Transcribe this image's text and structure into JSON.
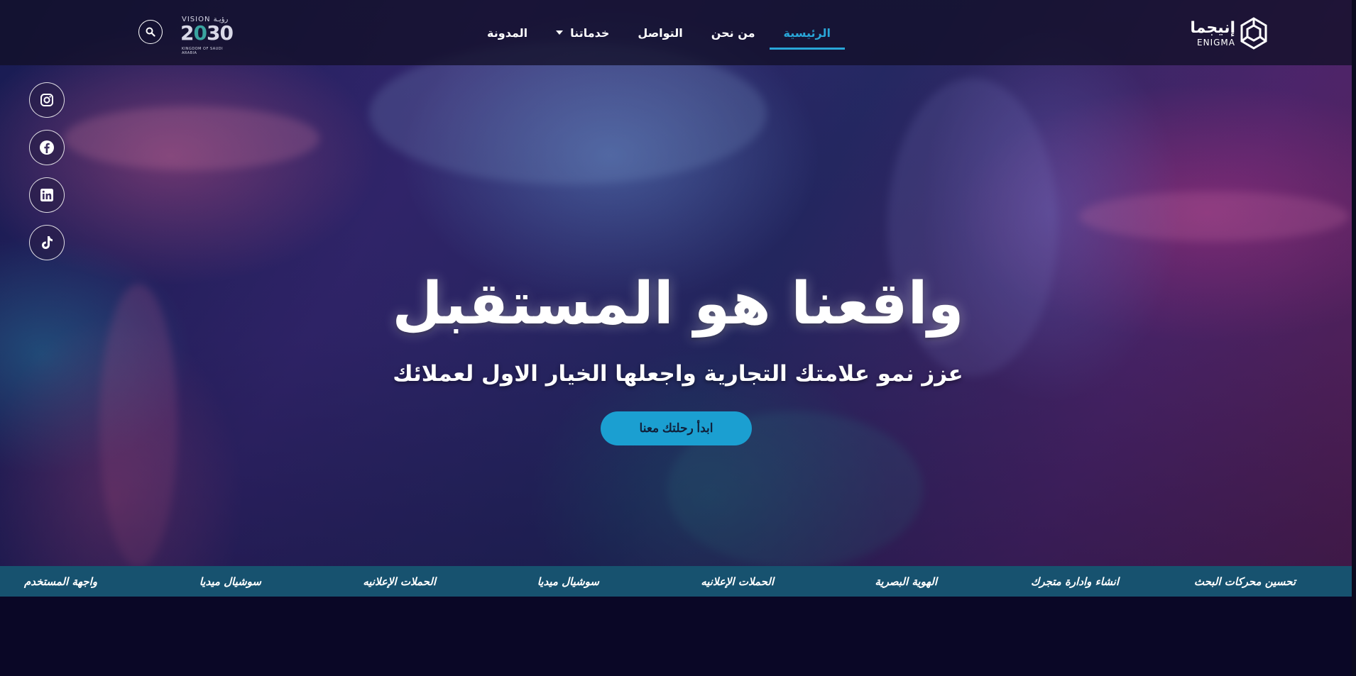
{
  "header": {
    "logo": {
      "arabic": "إنيجما",
      "english": "ENIGMA"
    },
    "nav": [
      {
        "label": "الرئيسية",
        "active": true
      },
      {
        "label": "من نحن",
        "active": false
      },
      {
        "label": "التواصل",
        "active": false
      },
      {
        "label": "خدماتنا",
        "active": false,
        "dropdown": true
      },
      {
        "label": "المدونة",
        "active": false
      }
    ],
    "vision": {
      "line1": "VISION رؤيـة",
      "year": "2030",
      "line3": "KINGDOM OF SAUDI ARABIA"
    },
    "search_icon": "search-icon"
  },
  "social": [
    {
      "name": "instagram-icon"
    },
    {
      "name": "facebook-icon"
    },
    {
      "name": "linkedin-icon"
    },
    {
      "name": "tiktok-icon"
    }
  ],
  "hero": {
    "title": "واقعنا هو المستقبل",
    "subtitle": "عزز نمو علامتك التجارية واجعلها الخيار الاول لعملائك",
    "cta": "ابدأ رحلتك معنا"
  },
  "ticker": [
    "تحسين محركات البحث",
    "انشاء وادارة متجرك",
    "الهوية البصرية",
    "الحملات الإعلانيه",
    "سوشيال ميديا",
    "الحملات الإعلانيه",
    "سوشيال ميديا",
    "واجهة المستخدم"
  ],
  "colors": {
    "accent": "#29a6d8",
    "ticker_bg": "#17526f",
    "page_bg": "#0a0726",
    "cta_bg": "#1b9fd1"
  }
}
